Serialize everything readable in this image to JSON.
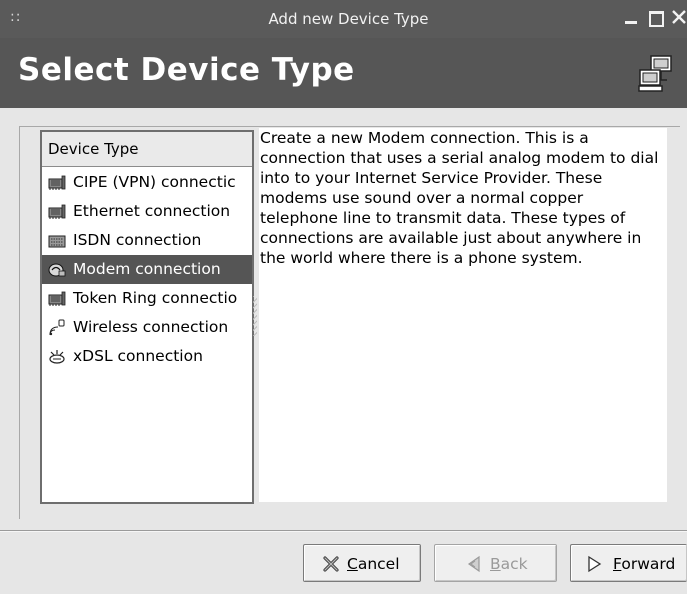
{
  "window": {
    "title": "Add new Device Type",
    "grip": "::"
  },
  "header": {
    "title": "Select Device Type",
    "icon": "network-computers-icon"
  },
  "device_list": {
    "column_header": "Device Type",
    "items": [
      {
        "label": "CIPE (VPN) connectic",
        "icon": "network-card-icon",
        "selected": false
      },
      {
        "label": "Ethernet connection",
        "icon": "network-card-icon",
        "selected": false
      },
      {
        "label": "ISDN connection",
        "icon": "isdn-card-icon",
        "selected": false
      },
      {
        "label": "Modem connection",
        "icon": "modem-icon",
        "selected": true
      },
      {
        "label": "Token Ring connectio",
        "icon": "network-card-icon",
        "selected": false
      },
      {
        "label": "Wireless connection",
        "icon": "wireless-icon",
        "selected": false
      },
      {
        "label": "xDSL connection",
        "icon": "xdsl-icon",
        "selected": false
      }
    ]
  },
  "description": {
    "lines": [
      "Create a new Modem connection.  This is a",
      "connection that uses a serial analog modem to dial",
      "into to your Internet Service Provider. These",
      "modems use sound over a normal copper",
      "telephone line to transmit data.  These types of",
      "connections are available just about anywhere in",
      "the world where there is a phone system."
    ]
  },
  "buttons": {
    "cancel": {
      "mnemonic": "C",
      "rest": "ancel",
      "icon": "cancel-x-icon",
      "enabled": true
    },
    "back": {
      "mnemonic": "B",
      "rest": "ack",
      "icon": "back-arrow-icon",
      "enabled": false
    },
    "forward": {
      "mnemonic": "F",
      "rest": "orward",
      "icon": "forward-arrow-icon",
      "enabled": true
    }
  },
  "colors": {
    "banner": "#565656",
    "titlebar": "#5a5a5a",
    "selection": "#555555"
  }
}
